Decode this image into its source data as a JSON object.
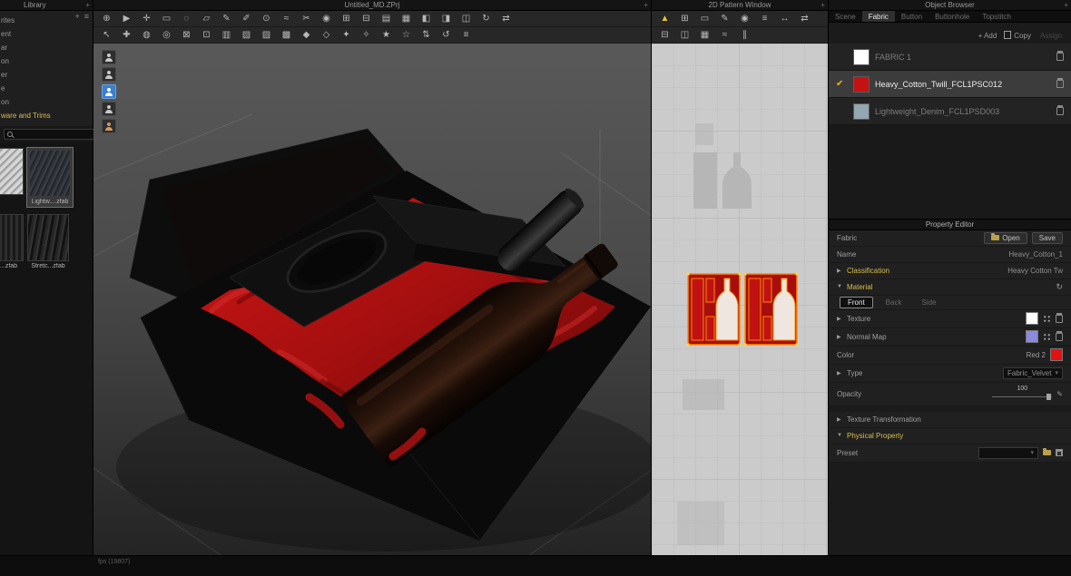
{
  "titlebar": {
    "library": "Library",
    "viewport": "Untitled_MD.ZPrj",
    "pattern": "2D Pattern Window",
    "browser": "Object Browser"
  },
  "icons": {
    "pin": "+",
    "plus": "+",
    "menu": "≡",
    "grid": "⊞",
    "check": "✔",
    "caret_right": "▶",
    "caret_down": "▼",
    "refresh": "↻",
    "pen": "✎",
    "dropdown": "▾"
  },
  "status": {
    "fps": "fps (19807)"
  },
  "library": {
    "items": [
      {
        "label": "rites"
      },
      {
        "label": "ent"
      },
      {
        "label": "ar"
      },
      {
        "label": "on"
      },
      {
        "label": "er"
      },
      {
        "label": "e"
      },
      {
        "label": "on"
      },
      {
        "label": "ware and Trims",
        "color": "#d8bf4c"
      }
    ],
    "thumbnails": [
      {
        "label": ""
      },
      {
        "label": "Lightw....zfab"
      },
      {
        "label": "...zfab"
      },
      {
        "label": "Stretc...zfab"
      }
    ]
  },
  "toolbar3d": {
    "row1": [
      {
        "name": "gizmo-tool-icon",
        "glyph": "⊕"
      },
      {
        "name": "simulate-tool-icon",
        "glyph": "▶"
      },
      {
        "name": "select-move-tool-icon",
        "glyph": "✛"
      },
      {
        "name": "select-box-tool-icon",
        "glyph": "▭"
      },
      {
        "name": "select-lasso-tool-icon",
        "glyph": "◌"
      },
      {
        "name": "transform-pattern-tool-icon",
        "glyph": "▱"
      },
      {
        "name": "edit-pattern-tool-icon",
        "glyph": "✎"
      },
      {
        "name": "edit-curve-tool-icon",
        "glyph": "✐"
      },
      {
        "name": "pin-tool-icon",
        "glyph": "⊙"
      },
      {
        "name": "segment-sewing-tool-icon",
        "glyph": "≈"
      },
      {
        "name": "free-sewing-tool-icon",
        "glyph": "✂"
      },
      {
        "name": "tack-tool-icon",
        "glyph": "◉"
      },
      {
        "name": "fold-arrangement-tool-icon",
        "glyph": "⊞"
      },
      {
        "name": "wind-tool-icon",
        "glyph": "⊟"
      },
      {
        "name": "button-tool-icon",
        "glyph": "▤"
      },
      {
        "name": "buttonhole-tool-icon",
        "glyph": "▦"
      },
      {
        "name": "zipper-tool-icon",
        "glyph": "◧"
      },
      {
        "name": "trim-tool-icon",
        "glyph": "◨"
      },
      {
        "name": "piping-tool-icon",
        "glyph": "◫"
      },
      {
        "name": "refresh-tool-icon",
        "glyph": "↻"
      },
      {
        "name": "sync-tool-icon",
        "glyph": "⇄"
      }
    ],
    "row2": [
      {
        "name": "arrange-tool-icon",
        "glyph": "↖"
      },
      {
        "name": "add-tool-icon",
        "glyph": "✚"
      },
      {
        "name": "avatar-tool-icon",
        "glyph": "◍"
      },
      {
        "name": "target-tool-icon",
        "glyph": "◎"
      },
      {
        "name": "delete-box-tool-icon",
        "glyph": "⊠"
      },
      {
        "name": "solid-box-tool-icon",
        "glyph": "⊡"
      },
      {
        "name": "texture-tool-icon",
        "glyph": "▥"
      },
      {
        "name": "hatch-a-tool-icon",
        "glyph": "▧"
      },
      {
        "name": "hatch-b-tool-icon",
        "glyph": "▨"
      },
      {
        "name": "hatch-c-tool-icon",
        "glyph": "▩"
      },
      {
        "name": "diamond-tool-icon",
        "glyph": "◆"
      },
      {
        "name": "diamond-outline-tool-icon",
        "glyph": "◇"
      },
      {
        "name": "sparkle-tool-icon",
        "glyph": "✦"
      },
      {
        "name": "sparkle-outline-tool-icon",
        "glyph": "✧"
      },
      {
        "name": "star-tool-icon",
        "glyph": "★"
      },
      {
        "name": "star-outline-tool-icon",
        "glyph": "☆"
      },
      {
        "name": "swap-tool-icon",
        "glyph": "⇅"
      },
      {
        "name": "undo-tool-icon",
        "glyph": "↺"
      },
      {
        "name": "list-tool-icon",
        "glyph": "≡"
      }
    ]
  },
  "toolbar2d": {
    "row1": [
      {
        "name": "pattern-alert-icon",
        "glyph": "▲",
        "color": "#e7c43b"
      },
      {
        "name": "grid-toggle-icon",
        "glyph": "⊞"
      },
      {
        "name": "rect-pattern-tool-icon",
        "glyph": "▭"
      },
      {
        "name": "pen-pattern-tool-icon",
        "glyph": "✎"
      },
      {
        "name": "point-edit-tool-icon",
        "glyph": "◉"
      },
      {
        "name": "list-view-icon",
        "glyph": "≡"
      },
      {
        "name": "move-horizontal-tool-icon",
        "glyph": "↔"
      },
      {
        "name": "sync-2d-icon",
        "glyph": "⇄"
      }
    ],
    "row2": [
      {
        "name": "trace-tool-icon",
        "glyph": "⊟"
      },
      {
        "name": "panel-tool-icon",
        "glyph": "◫"
      },
      {
        "name": "grid-tool-icon",
        "glyph": "▦"
      },
      {
        "name": "seamline-tool-icon",
        "glyph": "≈"
      },
      {
        "name": "grainline-tool-icon",
        "glyph": "∥"
      }
    ]
  },
  "object_browser": {
    "tabs": [
      {
        "label": "Scene"
      },
      {
        "label": "Fabric"
      },
      {
        "label": "Button"
      },
      {
        "label": "Buttonhole"
      },
      {
        "label": "Topstitch"
      }
    ],
    "add_label": "+ Add",
    "copy_label": "Copy",
    "assign_label": "Assign",
    "fabrics": {
      "f1": {
        "name": "FABRIC 1",
        "swatch": "#ffffff"
      },
      "f2": {
        "name": "Heavy_Cotton_Twill_FCL1PSC012",
        "swatch": "#c41212"
      },
      "f3": {
        "name": "Lightweight_Denim_FCL1PSD003",
        "swatch": "#93a7b0"
      }
    }
  },
  "property_editor": {
    "title": "Property Editor",
    "fabric_label": "Fabric",
    "open_label": "Open",
    "save_label": "Save",
    "name_label": "Name",
    "name_value": "Heavy_Cotton_1",
    "classification_label": "Classification",
    "classification_value": "Heavy Cotton Tw",
    "material_label": "Material",
    "material_tabs": [
      {
        "label": "Front"
      },
      {
        "label": "Back"
      },
      {
        "label": "Side"
      }
    ],
    "texture_label": "Texture",
    "texture_swatch": "#ffffff",
    "normal_label": "Normal Map",
    "normal_swatch": "#8a8ae0",
    "color_label": "Color",
    "color_value": "Red 2",
    "color_swatch": "#e01212",
    "type_label": "Type",
    "type_value": "Fabric_Velvet",
    "opacity_label": "Opacity",
    "opacity_value": "100",
    "transform_label": "Texture Transformation",
    "physical_label": "Physical Property",
    "preset_label": "Preset"
  }
}
